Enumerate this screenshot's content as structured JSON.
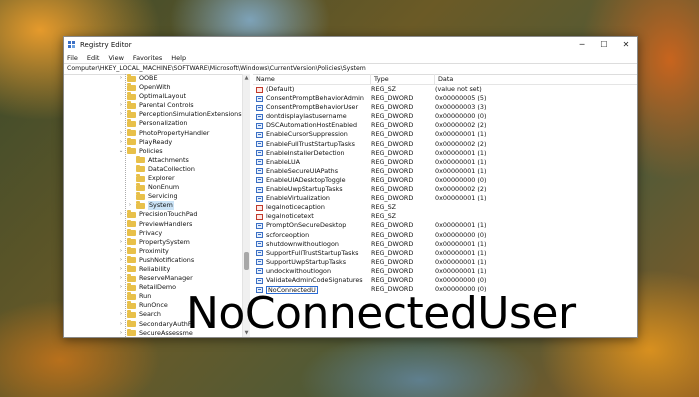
{
  "window": {
    "title": "Registry Editor",
    "controls": {
      "minimize": "─",
      "maximize": "☐",
      "close": "✕"
    }
  },
  "menu": [
    "File",
    "Edit",
    "View",
    "Favorites",
    "Help"
  ],
  "address": "Computer\\HKEY_LOCAL_MACHINE\\SOFTWARE\\Microsoft\\Windows\\CurrentVersion\\Policies\\System",
  "tree": [
    {
      "label": "OOBE",
      "level": 0,
      "expander": "›"
    },
    {
      "label": "OpenWith",
      "level": 0,
      "expander": ""
    },
    {
      "label": "OptimalLayout",
      "level": 0,
      "expander": ""
    },
    {
      "label": "Parental Controls",
      "level": 0,
      "expander": "›"
    },
    {
      "label": "PerceptionSimulationExtensions",
      "level": 0,
      "expander": "›"
    },
    {
      "label": "Personalization",
      "level": 0,
      "expander": ""
    },
    {
      "label": "PhotoPropertyHandler",
      "level": 0,
      "expander": "›"
    },
    {
      "label": "PlayReady",
      "level": 0,
      "expander": "›"
    },
    {
      "label": "Policies",
      "level": 0,
      "expander": "⌄"
    },
    {
      "label": "Attachments",
      "level": 1,
      "expander": ""
    },
    {
      "label": "DataCollection",
      "level": 1,
      "expander": ""
    },
    {
      "label": "Explorer",
      "level": 1,
      "expander": ""
    },
    {
      "label": "NonEnum",
      "level": 1,
      "expander": ""
    },
    {
      "label": "Servicing",
      "level": 1,
      "expander": ""
    },
    {
      "label": "System",
      "level": 1,
      "expander": "›",
      "selected": true
    },
    {
      "label": "PrecisionTouchPad",
      "level": 0,
      "expander": "›"
    },
    {
      "label": "PreviewHandlers",
      "level": 0,
      "expander": ""
    },
    {
      "label": "Privacy",
      "level": 0,
      "expander": ""
    },
    {
      "label": "PropertySystem",
      "level": 0,
      "expander": "›"
    },
    {
      "label": "Proximity",
      "level": 0,
      "expander": "›"
    },
    {
      "label": "PushNotifications",
      "level": 0,
      "expander": "›"
    },
    {
      "label": "Reliability",
      "level": 0,
      "expander": "›"
    },
    {
      "label": "ReserveManager",
      "level": 0,
      "expander": "›"
    },
    {
      "label": "RetailDemo",
      "level": 0,
      "expander": "›"
    },
    {
      "label": "Run",
      "level": 0,
      "expander": ""
    },
    {
      "label": "RunOnce",
      "level": 0,
      "expander": ""
    },
    {
      "label": "Search",
      "level": 0,
      "expander": "›"
    },
    {
      "label": "SecondaryAuthFa",
      "level": 0,
      "expander": "›"
    },
    {
      "label": "SecureAssessme",
      "level": 0,
      "expander": "›"
    },
    {
      "label": "Security and Mai",
      "level": 0,
      "expander": "›"
    }
  ],
  "columns": {
    "name": "Name",
    "type": "Type",
    "data": "Data"
  },
  "values": [
    {
      "icon": "sz",
      "name": "(Default)",
      "type": "REG_SZ",
      "data": "(value not set)"
    },
    {
      "icon": "dword",
      "name": "ConsentPromptBehaviorAdmin",
      "type": "REG_DWORD",
      "data": "0x00000005 (5)"
    },
    {
      "icon": "dword",
      "name": "ConsentPromptBehaviorUser",
      "type": "REG_DWORD",
      "data": "0x00000003 (3)"
    },
    {
      "icon": "dword",
      "name": "dontdisplaylastusername",
      "type": "REG_DWORD",
      "data": "0x00000000 (0)"
    },
    {
      "icon": "dword",
      "name": "DSCAutomationHostEnabled",
      "type": "REG_DWORD",
      "data": "0x00000002 (2)"
    },
    {
      "icon": "dword",
      "name": "EnableCursorSuppression",
      "type": "REG_DWORD",
      "data": "0x00000001 (1)"
    },
    {
      "icon": "dword",
      "name": "EnableFullTrustStartupTasks",
      "type": "REG_DWORD",
      "data": "0x00000002 (2)"
    },
    {
      "icon": "dword",
      "name": "EnableInstallerDetection",
      "type": "REG_DWORD",
      "data": "0x00000001 (1)"
    },
    {
      "icon": "dword",
      "name": "EnableLUA",
      "type": "REG_DWORD",
      "data": "0x00000001 (1)"
    },
    {
      "icon": "dword",
      "name": "EnableSecureUIAPaths",
      "type": "REG_DWORD",
      "data": "0x00000001 (1)"
    },
    {
      "icon": "dword",
      "name": "EnableUIADesktopToggle",
      "type": "REG_DWORD",
      "data": "0x00000000 (0)"
    },
    {
      "icon": "dword",
      "name": "EnableUwpStartupTasks",
      "type": "REG_DWORD",
      "data": "0x00000002 (2)"
    },
    {
      "icon": "dword",
      "name": "EnableVirtualization",
      "type": "REG_DWORD",
      "data": "0x00000001 (1)"
    },
    {
      "icon": "sz",
      "name": "legalnoticecaption",
      "type": "REG_SZ",
      "data": ""
    },
    {
      "icon": "sz",
      "name": "legalnoticetext",
      "type": "REG_SZ",
      "data": ""
    },
    {
      "icon": "dword",
      "name": "PromptOnSecureDesktop",
      "type": "REG_DWORD",
      "data": "0x00000001 (1)"
    },
    {
      "icon": "dword",
      "name": "scforceoption",
      "type": "REG_DWORD",
      "data": "0x00000000 (0)"
    },
    {
      "icon": "dword",
      "name": "shutdownwithoutlogon",
      "type": "REG_DWORD",
      "data": "0x00000001 (1)"
    },
    {
      "icon": "dword",
      "name": "SupportFullTrustStartupTasks",
      "type": "REG_DWORD",
      "data": "0x00000001 (1)"
    },
    {
      "icon": "dword",
      "name": "SupportUwpStartupTasks",
      "type": "REG_DWORD",
      "data": "0x00000001 (1)"
    },
    {
      "icon": "dword",
      "name": "undockwithoutlogon",
      "type": "REG_DWORD",
      "data": "0x00000001 (1)"
    },
    {
      "icon": "dword",
      "name": "ValidateAdminCodeSignatures",
      "type": "REG_DWORD",
      "data": "0x00000000 (0)"
    },
    {
      "icon": "dword",
      "name": "NoConnectedU",
      "type": "REG_DWORD",
      "data": "0x00000000 (0)",
      "editing": true
    }
  ],
  "overlay_caption": "NoConnectedUser",
  "colors": {
    "selection": "#cce4f7",
    "folder": "#e8c04a",
    "edit_border": "#2b6cd4"
  }
}
